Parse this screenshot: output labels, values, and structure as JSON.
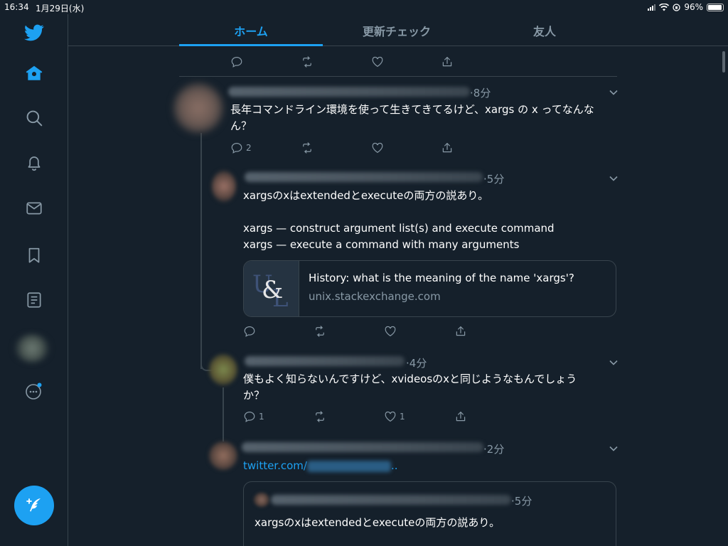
{
  "status_bar": {
    "time": "16:34",
    "date": "1月29日(水)",
    "battery": "96%",
    "battery_level": 0.96
  },
  "sidebar": {
    "items": [
      {
        "icon": "twitter-bird-icon"
      },
      {
        "icon": "home-icon"
      },
      {
        "icon": "search-icon"
      },
      {
        "icon": "notifications-bell-icon"
      },
      {
        "icon": "messages-envelope-icon"
      },
      {
        "icon": "bookmark-icon"
      },
      {
        "icon": "lists-icon"
      },
      {
        "icon": "profile-avatar"
      },
      {
        "icon": "more-icon"
      }
    ],
    "compose_icon": "compose-tweet-icon"
  },
  "tabs": [
    {
      "label": "ホーム",
      "active": true
    },
    {
      "label": "更新チェック",
      "active": false
    },
    {
      "label": "友人",
      "active": false
    }
  ],
  "colors": {
    "accent": "#1da1f2",
    "background": "#15202b",
    "border": "#38444d",
    "muted": "#8899a6"
  },
  "tweets": [
    {
      "time": "8分",
      "text_line1": "長年コマンドライン環境を使って生きてきてるけど、xargs の x ってなんな",
      "text_line2": "ん？",
      "reply_count": "2"
    },
    {
      "time": "5分",
      "line1": "xargsのxはextendedとexecuteの両方の説あり。",
      "line2": "xargs — construct argument list(s) and execute command",
      "line3": "xargs — execute a command with many arguments",
      "card": {
        "title": "History: what is the meaning of the name 'xargs'?",
        "domain": "unix.stackexchange.com",
        "thumb_text": "U&L"
      }
    },
    {
      "time": "4分",
      "text_line1": "僕もよく知らないんですけど、xvideosのxと同じようなもんでしょう",
      "text_line2": "か？",
      "reply_count": "1",
      "like_count": "1"
    },
    {
      "time": "2分",
      "link_prefix": "twitter.com/",
      "link_suffix": "..",
      "quote": {
        "time": "5分",
        "text": "xargsのxはextendedとexecuteの両方の説あり。"
      }
    }
  ]
}
